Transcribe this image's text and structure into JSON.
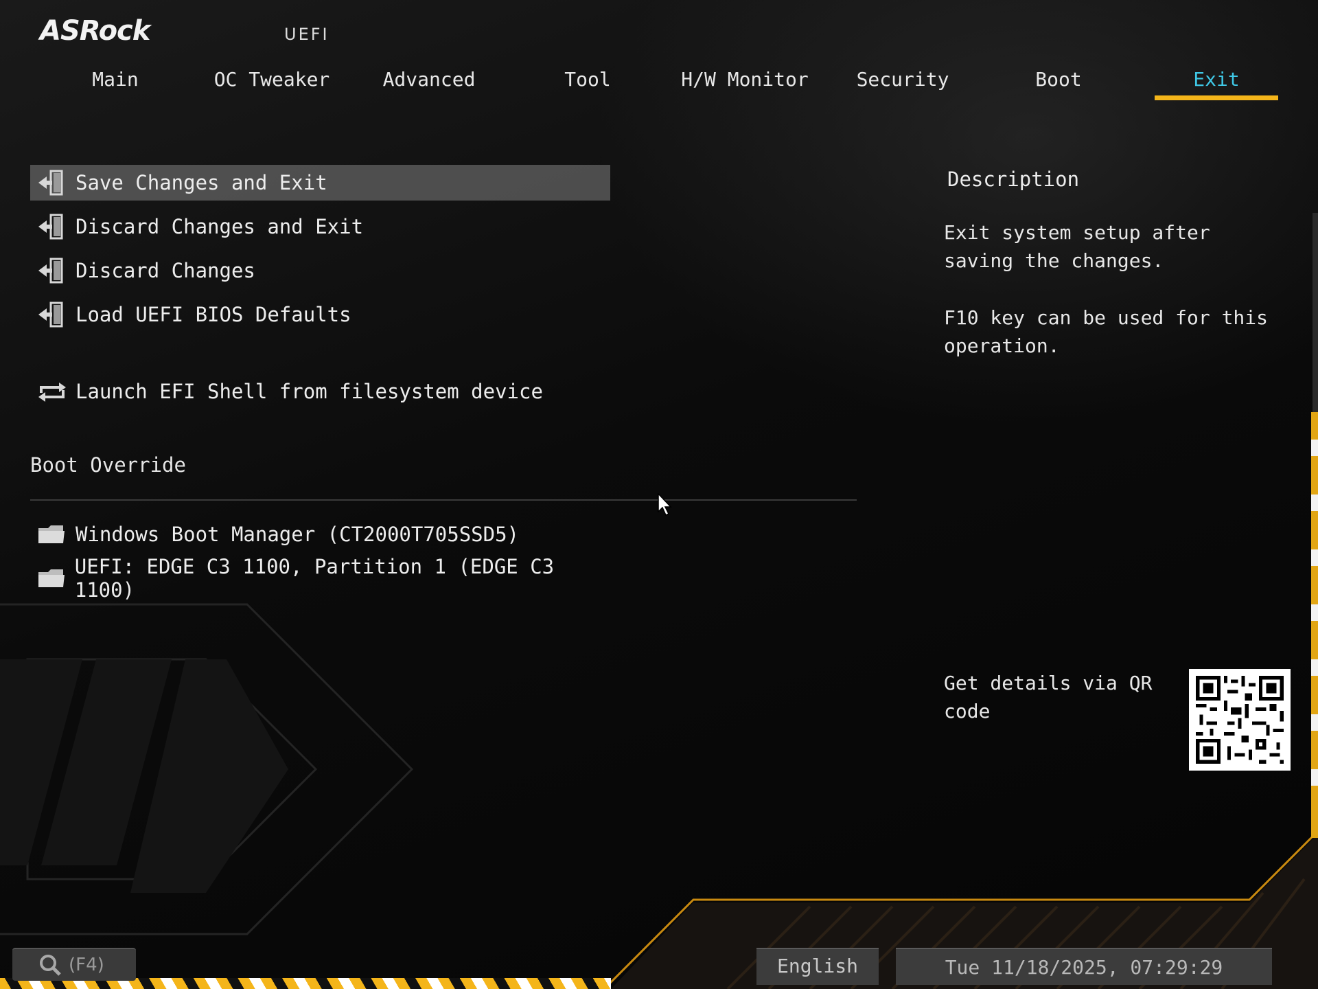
{
  "header": {
    "brand": "ASRock",
    "mode_label": "UEFI"
  },
  "tabs": [
    {
      "label": "Main"
    },
    {
      "label": "OC Tweaker"
    },
    {
      "label": "Advanced"
    },
    {
      "label": "Tool"
    },
    {
      "label": "H/W Monitor"
    },
    {
      "label": "Security"
    },
    {
      "label": "Boot"
    },
    {
      "label": "Exit",
      "active": true
    }
  ],
  "exit_menu": {
    "items": [
      {
        "label": "Save Changes and Exit",
        "icon": "exit-door-icon",
        "selected": true
      },
      {
        "label": "Discard Changes and Exit",
        "icon": "exit-door-icon"
      },
      {
        "label": "Discard Changes",
        "icon": "exit-door-icon"
      },
      {
        "label": "Load UEFI BIOS Defaults",
        "icon": "exit-door-icon"
      },
      {
        "label": "Launch EFI Shell from filesystem device",
        "icon": "shell-loop-icon"
      }
    ]
  },
  "boot_override": {
    "title": "Boot Override",
    "items": [
      {
        "label": "Windows Boot Manager (CT2000T705SSD5)",
        "icon": "folder-icon"
      },
      {
        "label": "UEFI: EDGE C3 1100, Partition 1 (EDGE C3 1100)",
        "icon": "folder-icon"
      }
    ]
  },
  "description": {
    "title": "Description",
    "line1": "Exit system setup after saving the changes.",
    "line2": "F10 key can be used for this operation.",
    "qr_text": "Get details via QR code"
  },
  "footer": {
    "search_label": "(F4)",
    "language": "English",
    "datetime": "Tue 11/18/2025, 07:29:29"
  },
  "colors": {
    "accent_yellow": "#f4b51a",
    "active_tab": "#3fc8e6",
    "selection": "#6e6e6e"
  }
}
